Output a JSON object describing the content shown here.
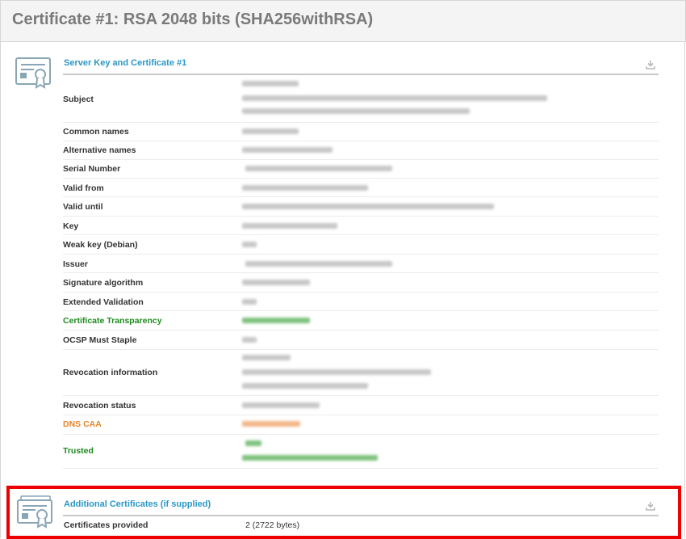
{
  "page": {
    "title": "Certificate #1: RSA 2048 bits (SHA256withRSA)"
  },
  "server_section": {
    "title": "Server Key and Certificate #1",
    "rows": [
      {
        "label": "Subject"
      },
      {
        "label": "Common names"
      },
      {
        "label": "Alternative names"
      },
      {
        "label": "Serial Number"
      },
      {
        "label": "Valid from"
      },
      {
        "label": "Valid until"
      },
      {
        "label": "Key"
      },
      {
        "label": "Weak key (Debian)"
      },
      {
        "label": "Issuer"
      },
      {
        "label": "Signature algorithm"
      },
      {
        "label": "Extended Validation"
      },
      {
        "label": "Certificate Transparency"
      },
      {
        "label": "OCSP Must Staple"
      },
      {
        "label": "Revocation information"
      },
      {
        "label": "Revocation status"
      },
      {
        "label": "DNS CAA"
      },
      {
        "label": "Trusted"
      }
    ]
  },
  "additional_section": {
    "title": "Additional Certificates (if supplied)",
    "rows": [
      {
        "label": "Certificates provided",
        "value": "2 (2722 bytes)"
      }
    ]
  },
  "colors": {
    "section_title": "#2a97c7",
    "label_green": "#1e8a1e",
    "label_orange": "#e8842b",
    "highlight": "#ee0000"
  },
  "icons": [
    "certificate-icon",
    "download-icon"
  ]
}
